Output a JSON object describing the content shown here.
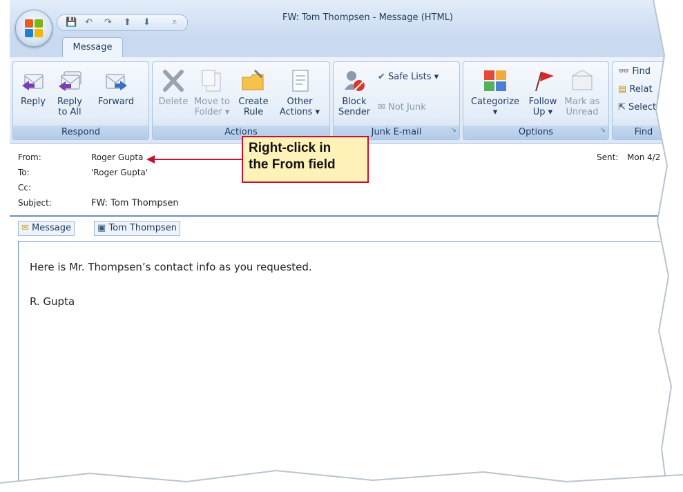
{
  "window": {
    "title": "FW: Tom Thompsen - Message (HTML)",
    "quick_access": [
      "save-icon",
      "undo-icon",
      "redo-icon",
      "up-arrow-icon",
      "down-arrow-icon",
      "customize-icon"
    ]
  },
  "tabs": [
    "Message"
  ],
  "ribbon": {
    "groups": {
      "respond": "Respond",
      "actions": "Actions",
      "junk": "Junk E-mail",
      "options": "Options",
      "find": "Find"
    },
    "reply": "Reply",
    "reply_all_1": "Reply",
    "reply_all_2": "to All",
    "forward": "Forward",
    "delete": "Delete",
    "move_1": "Move to",
    "move_2": "Folder",
    "create_1": "Create",
    "create_2": "Rule",
    "other_1": "Other",
    "other_2": "Actions",
    "block_1": "Block",
    "block_2": "Sender",
    "safe_lists": "Safe Lists",
    "not_junk": "Not Junk",
    "categorize": "Categorize",
    "follow_1": "Follow",
    "follow_2": "Up",
    "mark_1": "Mark as",
    "mark_2": "Unread",
    "find": "Find",
    "related": "Relat",
    "select": "Select"
  },
  "header": {
    "from_label": "From:",
    "from_value": "Roger Gupta",
    "to_label": "To:",
    "to_value": "'Roger Gupta'",
    "cc_label": "Cc:",
    "subject_label": "Subject:",
    "subject_value": "FW: Tom Thompsen",
    "sent_label": "Sent:",
    "sent_value": "Mon 4/2"
  },
  "attachments": {
    "message": "Message",
    "contact": "Tom Thompsen"
  },
  "body": {
    "line1": "Here is Mr. Thompsen’s contact info as you requested.",
    "line2": "R. Gupta"
  },
  "callout": {
    "line1": "Right-click in",
    "line2": "the From field"
  },
  "colors": {
    "accent": "#c8102e",
    "callout_bg": "#fff2b8",
    "ribbon_bg": "#dbe7f5"
  }
}
